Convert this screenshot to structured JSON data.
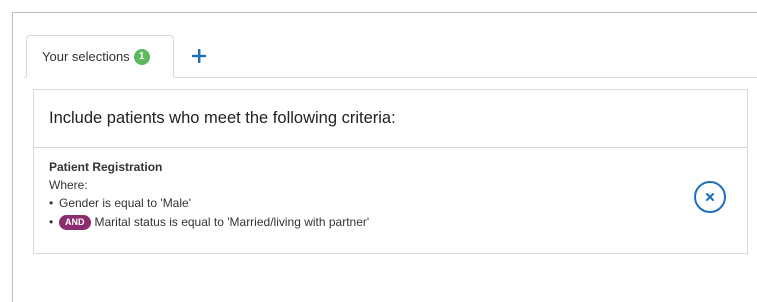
{
  "tabs": [
    {
      "label": "Your selections",
      "count": "1",
      "active": true
    }
  ],
  "add_tab_icon": "plus-icon",
  "panel": {
    "heading": "Include patients who meet the following criteria:",
    "criteria": {
      "title": "Patient Registration",
      "where_label": "Where:",
      "conditions": [
        {
          "operator": "",
          "text": "Gender is equal to 'Male'"
        },
        {
          "operator": "AND",
          "text": "Marital status is equal to 'Married/living with partner'"
        }
      ]
    },
    "remove_icon": "close-icon"
  },
  "colors": {
    "count_badge": "#5cb85c",
    "and_badge": "#8b2d6e",
    "accent_blue": "#1f6fbf"
  }
}
